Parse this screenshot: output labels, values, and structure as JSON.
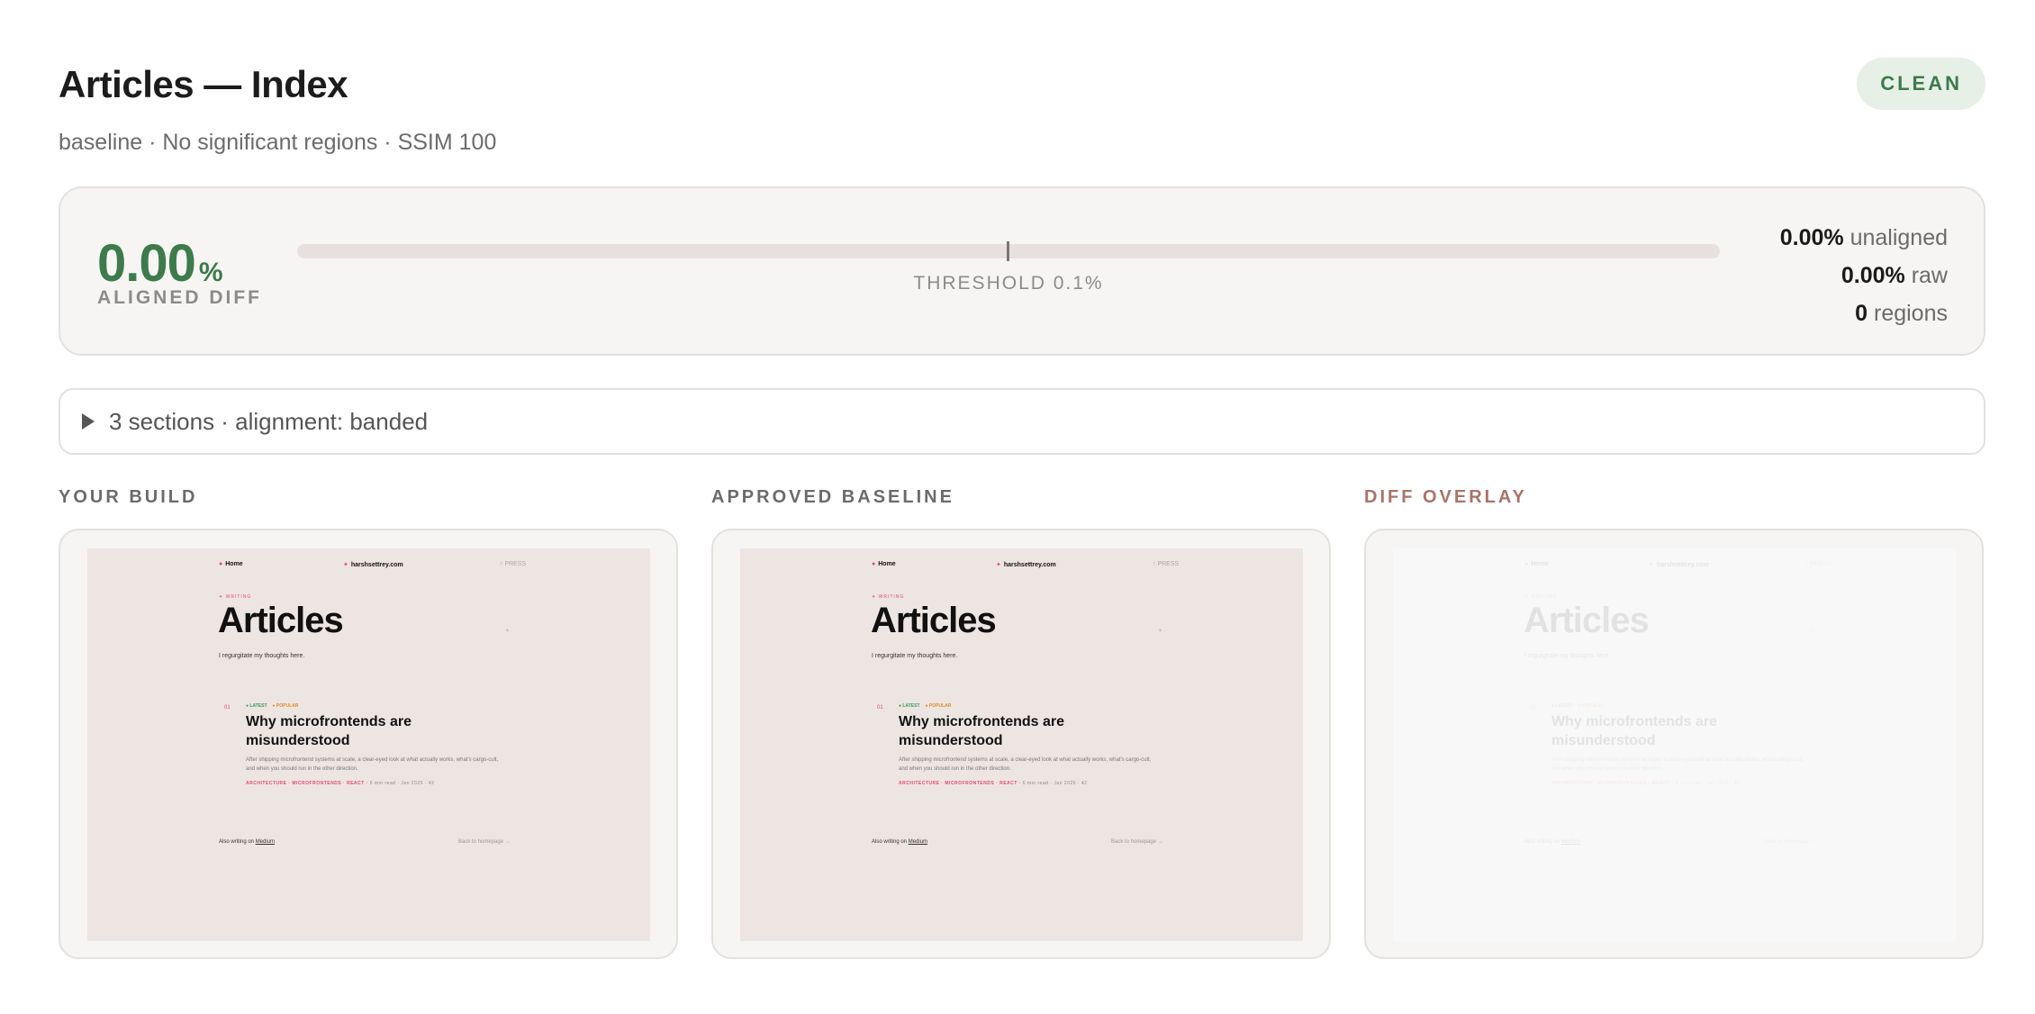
{
  "header": {
    "title": "Articles — Index",
    "subtitle": "baseline · No significant regions · SSIM 100",
    "status": "CLEAN"
  },
  "summary": {
    "aligned_value": "0.00",
    "aligned_unit": "%",
    "aligned_label": "ALIGNED DIFF",
    "threshold_label": "THRESHOLD 0.1%",
    "metrics": [
      {
        "value": "0.00%",
        "label": "unaligned"
      },
      {
        "value": "0.00%",
        "label": "raw"
      },
      {
        "value": "0",
        "label": "regions"
      }
    ]
  },
  "sections": {
    "label": "3 sections · alignment: banded"
  },
  "panels": {
    "build_label": "YOUR BUILD",
    "baseline_label": "APPROVED BASELINE",
    "diff_label": "DIFF OVERLAY"
  },
  "preview": {
    "nav_home": "Home",
    "nav_brand": "harshsettrey.com",
    "nav_press": "PRESS",
    "tag": "WRITING",
    "heading": "Articles",
    "tagline": "I regurgitate my thoughts here.",
    "badge_latest": "LATEST",
    "badge_popular": "POPULAR",
    "post_number": "01",
    "post_title": "Why microfrontends are misunderstood",
    "post_excerpt": "After shipping microfrontend systems at scale, a clear-eyed look at what actually works, what's cargo-cult, and when you should run in the other direction.",
    "post_tags": "ARCHITECTURE · MICROFRONTENDS · REACT",
    "post_meta": "6 min read · Jan 2025 · 42",
    "footer_left_prefix": "Also writing on",
    "footer_left_link": "Medium",
    "footer_right": "Back to homepage →"
  },
  "colors": {
    "accent_green": "#3d7a4c",
    "diff_label": "#a8746a",
    "preview_bg": "#ede5e2",
    "pink": "#e24b6a"
  }
}
